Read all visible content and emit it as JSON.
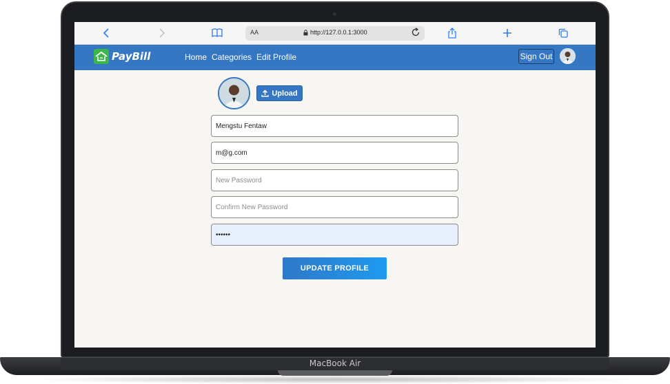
{
  "device": {
    "model_label": "MacBook Air"
  },
  "browser": {
    "text_size_label": "AA",
    "url": "http://127.0.0.1:3000",
    "icons": [
      "back-icon",
      "forward-icon",
      "bookmarks-icon",
      "lock-icon",
      "reload-icon",
      "share-icon",
      "new-tab-icon",
      "tabs-icon"
    ]
  },
  "navbar": {
    "brand": "PayBill",
    "links": [
      "Home",
      "Categories",
      "Edit Profile"
    ],
    "sign_out": "Sign Out",
    "colors": {
      "bar": "#3577c2",
      "logo": "#3cb54a"
    }
  },
  "profile": {
    "upload_label": "Upload",
    "name_value": "Mengstu Fentaw",
    "email_value": "m@g.com",
    "new_password_placeholder": "New Password",
    "confirm_password_placeholder": "Confirm New Password",
    "current_password_value": "••••••",
    "submit_label": "UPDATE PROFILE"
  }
}
